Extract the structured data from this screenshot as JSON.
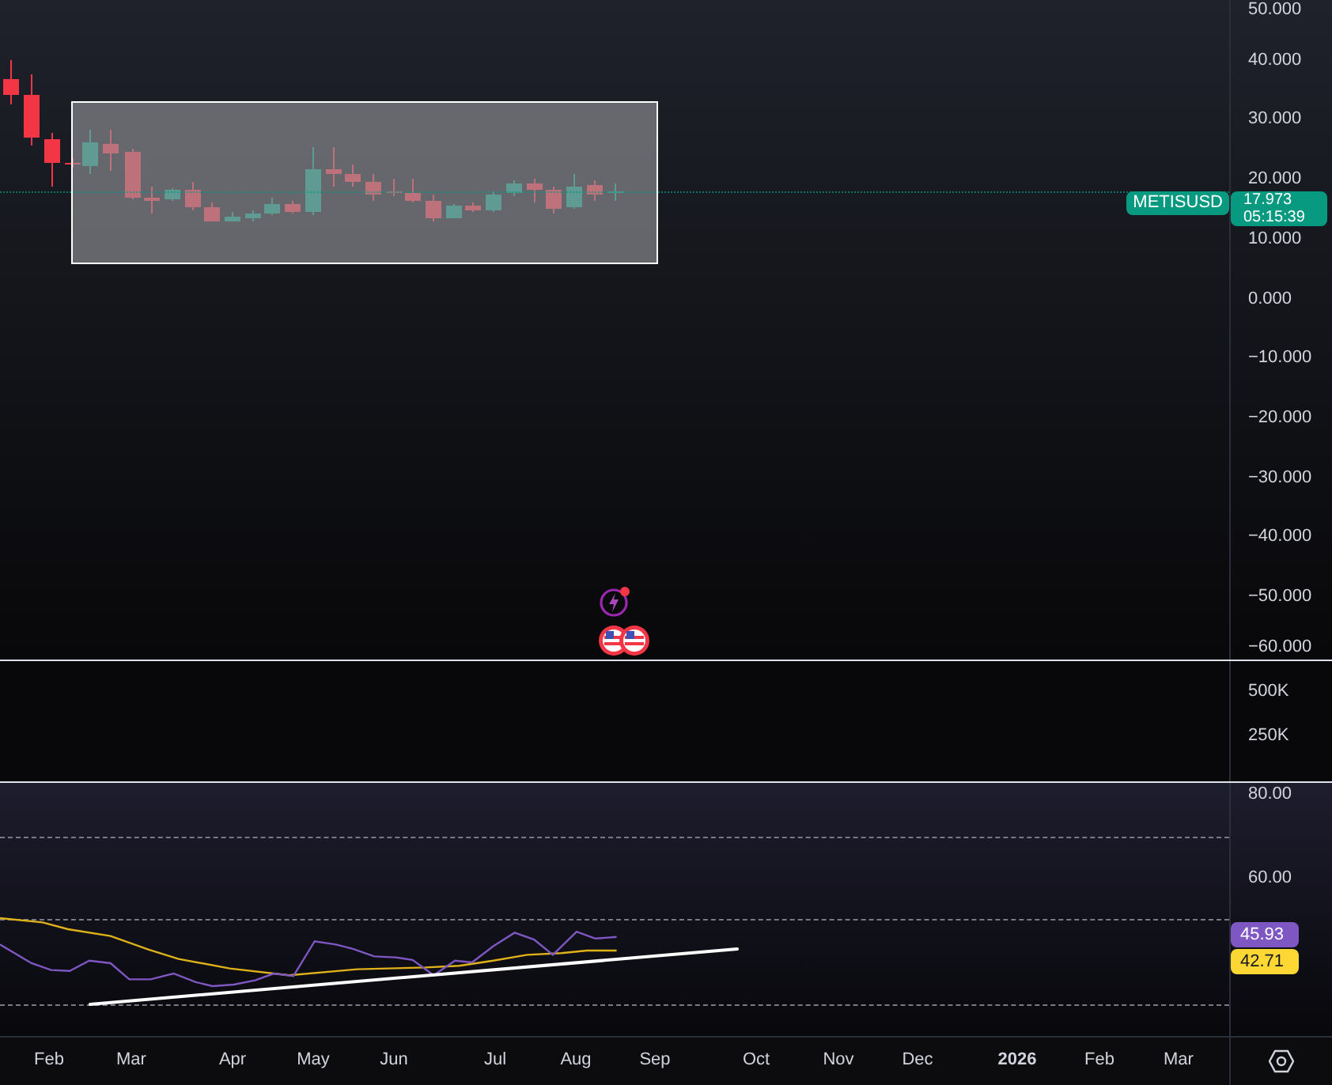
{
  "symbol_label": {
    "symbol": "METISUSD",
    "price": "17.973",
    "countdown": "05:15:39"
  },
  "price_axis": {
    "ticks": [
      "50.000",
      "40.000",
      "30.000",
      "20.000",
      "10.000",
      "0.000",
      "−10.000",
      "−20.000",
      "−30.000",
      "−40.000",
      "−50.000",
      "−60.000"
    ]
  },
  "volume_axis": {
    "ticks": [
      "500K",
      "250K"
    ]
  },
  "rsi_axis": {
    "ticks": [
      "80.00",
      "60.00"
    ],
    "badges": [
      {
        "value": "45.93",
        "color": "#7e57c2"
      },
      {
        "value": "42.71",
        "color": "#fdd835"
      }
    ]
  },
  "time_axis": {
    "labels": [
      {
        "text": "Feb",
        "kind": "month"
      },
      {
        "text": "Mar",
        "kind": "month"
      },
      {
        "text": "Apr",
        "kind": "month"
      },
      {
        "text": "May",
        "kind": "month"
      },
      {
        "text": "Jun",
        "kind": "month"
      },
      {
        "text": "Jul",
        "kind": "month"
      },
      {
        "text": "Aug",
        "kind": "month"
      },
      {
        "text": "Sep",
        "kind": "month"
      },
      {
        "text": "Oct",
        "kind": "month"
      },
      {
        "text": "Nov",
        "kind": "month"
      },
      {
        "text": "Dec",
        "kind": "month"
      },
      {
        "text": "2026",
        "kind": "year"
      },
      {
        "text": "Feb",
        "kind": "month"
      },
      {
        "text": "Mar",
        "kind": "month"
      }
    ]
  }
}
